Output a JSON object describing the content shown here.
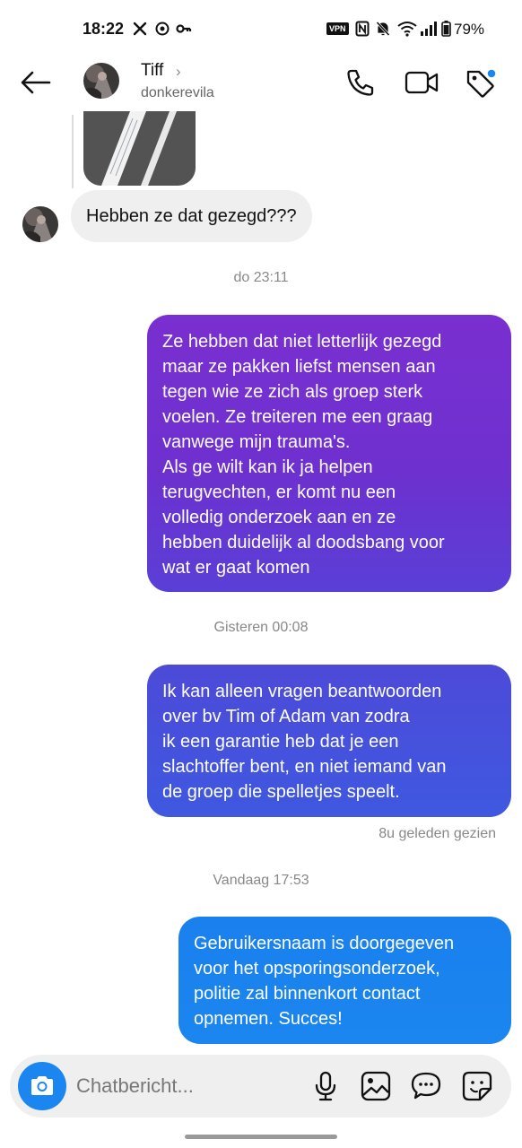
{
  "status_bar": {
    "time": "18:22",
    "vpn_label": "VPN",
    "battery": "79%"
  },
  "header": {
    "name": "Tiff",
    "chevron": "›",
    "username": "donkerevila"
  },
  "messages": {
    "incoming_1": "Hebben ze dat gezegd???",
    "timestamp_1": "do 23:11",
    "outgoing_1": "Ze hebben dat niet letterlijk gezegd\nmaar ze pakken liefst mensen aan\ntegen wie ze zich als groep sterk\nvoelen. Ze treiteren me een graag\nvanwege mijn trauma's.\nAls ge wilt kan ik ja helpen\nterugvechten, er komt nu een\nvolledig onderzoek aan en ze\nhebben duidelijk al doodsbang voor\nwat er gaat komen",
    "timestamp_2": "Gisteren 00:08",
    "outgoing_2": "Ik kan alleen vragen beantwoorden\nover bv Tim of Adam van zodra\nik een garantie heb dat je een\nslachtoffer bent, en niet iemand van\nde groep die spelletjes speelt.",
    "seen_status": "8u geleden gezien",
    "timestamp_3": "Vandaag 17:53",
    "outgoing_3": "Gebruikersnaam is doorgegeven\nvoor het opsporingsonderzoek,\npolitie zal binnenkort contact\nopnemen. Succes!"
  },
  "composer": {
    "placeholder": "Chatbericht..."
  },
  "colors": {
    "bubble_1": "#7a2fd0",
    "bubble_2": "#4d4ad8",
    "bubble_3": "#1a80ee",
    "camera_button": "#1b86ef",
    "notification_dot": "#1b86ef"
  },
  "icons": {
    "back": "arrow-left-icon",
    "call": "phone-icon",
    "video": "video-camera-icon",
    "tag": "tag-icon",
    "camera": "camera-icon",
    "mic": "microphone-icon",
    "gallery": "image-icon",
    "chat": "chat-bubble-icon",
    "sticker": "sticker-icon"
  }
}
